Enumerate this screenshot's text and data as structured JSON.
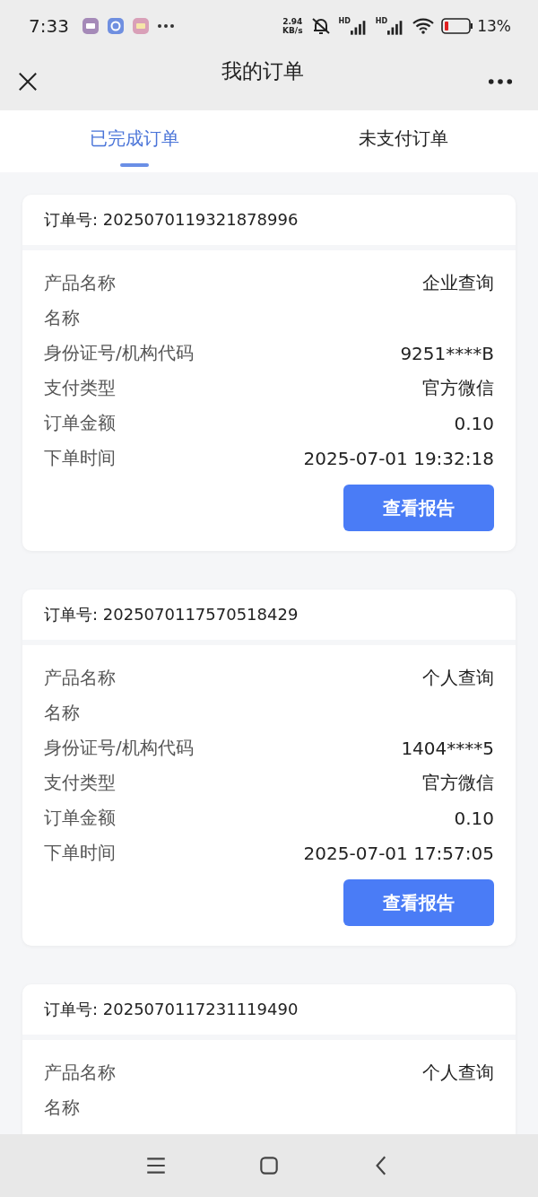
{
  "status_bar": {
    "time": "7:33",
    "speed_value": "2.94",
    "speed_unit": "KB/s",
    "signals": [
      "HD",
      "HD"
    ],
    "battery": "13%"
  },
  "header": {
    "title": "我的订单"
  },
  "tabs": [
    {
      "label": "已完成订单",
      "selected": true
    },
    {
      "label": "未支付订单",
      "selected": false
    }
  ],
  "orders": [
    {
      "number_label": "订单号: 2025070119321878996",
      "rows": [
        {
          "label": "产品名称",
          "value": "企业查询"
        },
        {
          "label": "名称"
        },
        {
          "label": "身份证号/机构代码",
          "value": "9251****B"
        },
        {
          "label": "支付类型",
          "value": "官方微信"
        },
        {
          "label": "订单金额",
          "value": "0.10"
        },
        {
          "label": "下单时间",
          "value": "2025-07-01 19:32:18"
        }
      ],
      "button": "查看报告"
    },
    {
      "number_label": "订单号: 2025070117570518429",
      "rows": [
        {
          "label": "产品名称",
          "value": "个人查询"
        },
        {
          "label": "名称"
        },
        {
          "label": "身份证号/机构代码",
          "value": "1404****5"
        },
        {
          "label": "支付类型",
          "value": "官方微信"
        },
        {
          "label": "订单金额",
          "value": "0.10"
        },
        {
          "label": "下单时间",
          "value": "2025-07-01 17:57:05"
        }
      ],
      "button": "查看报告"
    },
    {
      "number_label": "订单号: 2025070117231119490",
      "rows": [
        {
          "label": "产品名称",
          "value": "个人查询"
        },
        {
          "label": "名称"
        }
      ]
    }
  ]
}
